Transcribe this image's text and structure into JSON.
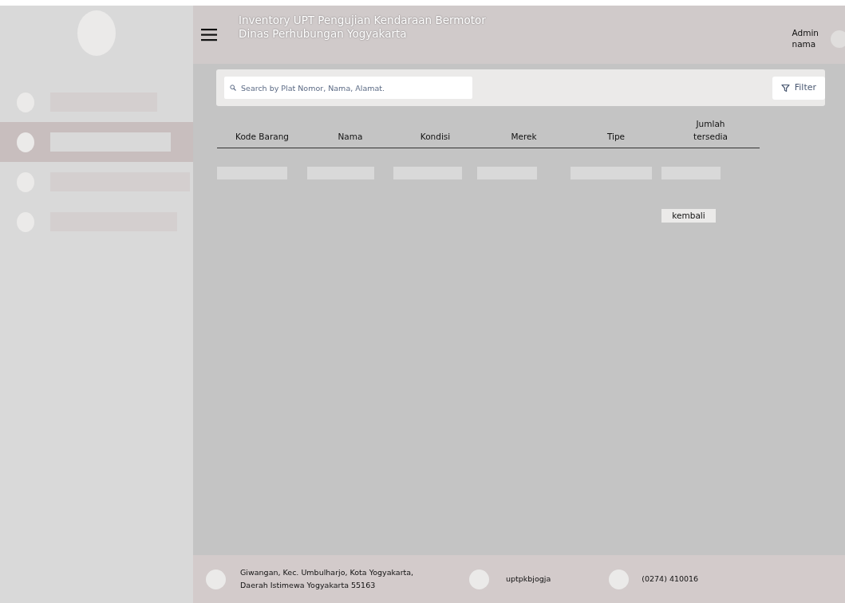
{
  "sidebar": {
    "items": [
      {
        "selected": false
      },
      {
        "selected": true
      },
      {
        "selected": false
      },
      {
        "selected": false
      }
    ]
  },
  "header": {
    "title_lines": [
      "Inventory UPT Pengujian Kendaraan Bermotor",
      "Dinas Perhubungan Yogyakarta"
    ],
    "user_lines": [
      "Admin",
      "nama"
    ]
  },
  "search": {
    "placeholder": "Search by Plat Nomor, Nama, Alamat."
  },
  "filter_button": "Filter",
  "table": {
    "columns": [
      "Kode Barang",
      "Nama",
      "Kondisi",
      "Merek",
      "Tipe",
      "Jumlah tersedia"
    ]
  },
  "back_button": "kembali",
  "footer": {
    "address_lines": [
      "Giwangan, Kec. Umbulharjo, Kota Yogyakarta,",
      "Daerah Istimewa Yogyakarta 55163"
    ],
    "social": "uptpkbjogja",
    "phone": "(0274) 410016"
  }
}
